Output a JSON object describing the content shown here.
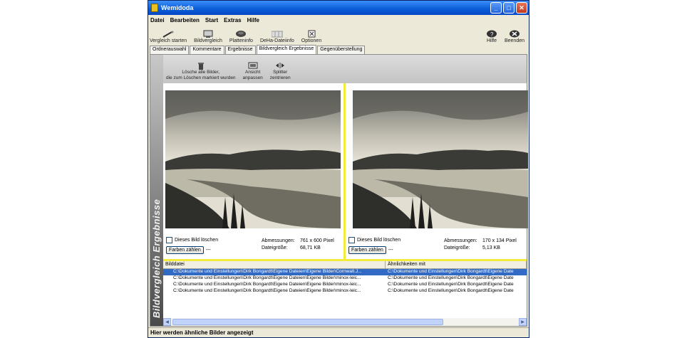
{
  "window": {
    "title": "Wemidoda"
  },
  "menu": [
    "Datei",
    "Bearbeiten",
    "Start",
    "Extras",
    "Hilfe"
  ],
  "toolbar": {
    "left": [
      "Vergleich starten",
      "Bildvergleich",
      "Platteninfo",
      "DeHa-Dateiinfo",
      "Optionen"
    ],
    "right": [
      "Hilfe",
      "Beenden"
    ]
  },
  "tabs": [
    "Ordnerauswahl",
    "Kommentare",
    "Ergebnisse",
    "Bildvergleich Ergebnisse",
    "Gegenüberstellung"
  ],
  "active_tab": "Bildvergleich Ergebnisse",
  "side_label": "Bildvergleich Ergebnisse",
  "pane_toolbar": {
    "delete_all": [
      "Lösche alle Bilder,",
      "die zum Löschen markiert wurden"
    ],
    "fit_view": [
      "Ansicht",
      "anpassen"
    ],
    "center_splitter": [
      "Splitter",
      "zentrieren"
    ]
  },
  "left_image": {
    "delete_label": "Dieses Bild löschen",
    "count_button": "Farben zählen",
    "count_value": "---",
    "dims_label": "Abmessungen:",
    "dims_value": "761 x 600 Pixel",
    "size_label": "Dateigröße:",
    "size_value": "68,71 KB"
  },
  "right_image": {
    "delete_label": "Dieses Bild löschen",
    "count_button": "Farben zählen",
    "count_value": "---",
    "dims_label": "Abmessungen:",
    "dims_value": "170 x 134 Pixel",
    "size_label": "Dateigröße:",
    "size_value": "5,13 KB"
  },
  "results": {
    "headers": [
      "Bilddatei",
      "Ähnlichkeiten mit"
    ],
    "rows": [
      [
        "C:\\Dokumente und Einstellungen\\Dirk Bongardt\\Eigene Dateien\\Eigene Bilder\\Cornwall.J...",
        "C:\\Dokumente und Einstellungen\\Dirk Bongardt\\Eigene Date"
      ],
      [
        "C:\\Dokumente und Einstellungen\\Dirk Bongardt\\Eigene Dateien\\Eigene Bilder\\minox-leic...",
        "C:\\Dokumente und Einstellungen\\Dirk Bongardt\\Eigene Date"
      ],
      [
        "C:\\Dokumente und Einstellungen\\Dirk Bongardt\\Eigene Dateien\\Eigene Bilder\\minox-leic...",
        "C:\\Dokumente und Einstellungen\\Dirk Bongardt\\Eigene Date"
      ],
      [
        "C:\\Dokumente und Einstellungen\\Dirk Bongardt\\Eigene Dateien\\Eigene Bilder\\minox-leic...",
        "C:\\Dokumente und Einstellungen\\Dirk Bongardt\\Eigene Date"
      ]
    ],
    "selected_row": 0
  },
  "status": "Hier werden ähnliche Bilder angezeigt"
}
